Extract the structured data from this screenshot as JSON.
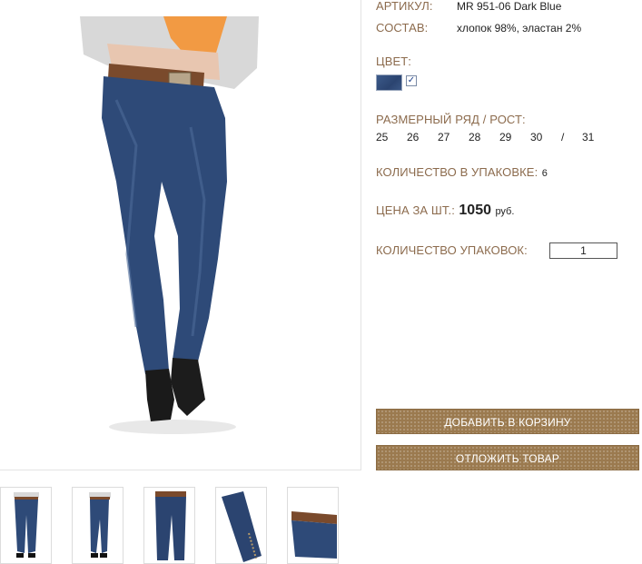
{
  "product": {
    "sku_label": "АРТИКУЛ:",
    "sku_value": "MR 951-06 Dark Blue",
    "composition_label": "СОСТАВ:",
    "composition_value": "хлопок 98%, эластан 2%",
    "color_label": "ЦВЕТ:",
    "color_swatch": "#2e4a78",
    "color_checked": "✓",
    "sizes_label": "РАЗМЕРНЫЙ РЯД / РОСТ:",
    "sizes": [
      "25",
      "26",
      "27",
      "28",
      "29",
      "30",
      "/",
      "31"
    ],
    "pack_qty_label": "КОЛИЧЕСТВО В УПАКОВКЕ:",
    "pack_qty_value": "6",
    "price_label": "ЦЕНА ЗА ШТ.:",
    "price_value": "1050",
    "price_currency": "руб.",
    "packs_label": "КОЛИЧЕСТВО УПАКОВОК:",
    "packs_value": "1"
  },
  "actions": {
    "add_to_cart": "ДОБАВИТЬ В КОРЗИНУ",
    "save_for_later": "ОТЛОЖИТЬ ТОВАР"
  },
  "colors": {
    "label": "#8c6b4d",
    "button": "#9b7a4f",
    "denim": "#2b4470"
  },
  "thumbnails": [
    "front-view",
    "side-view",
    "flat-lay",
    "leg-detail",
    "waist-detail"
  ]
}
